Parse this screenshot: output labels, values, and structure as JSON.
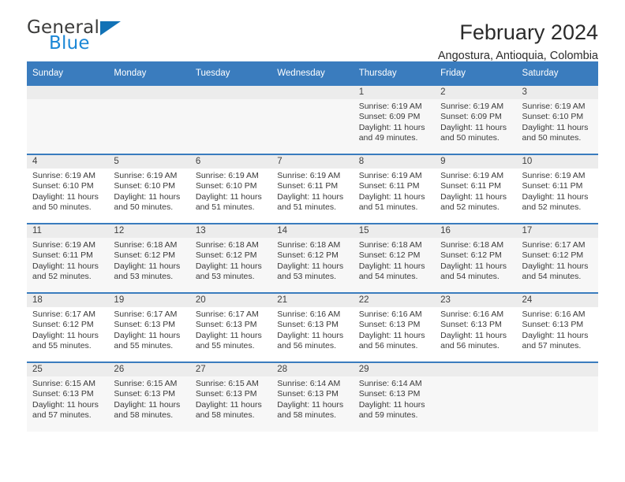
{
  "brand": {
    "name_top": "General",
    "name_bottom": "Blue",
    "triangle_color": "#1272b6",
    "blue_text_color": "#1b87d6"
  },
  "header": {
    "title": "February 2024",
    "subtitle": "Angostura, Antioquia, Colombia"
  },
  "theme": {
    "header_blue": "#3a7cbe",
    "daynum_band": "#ececec",
    "alt_row": "#f7f7f7",
    "text": "#3a3a3a"
  },
  "calendar": {
    "weekday_headers": [
      "Sunday",
      "Monday",
      "Tuesday",
      "Wednesday",
      "Thursday",
      "Friday",
      "Saturday"
    ],
    "weeks": [
      [
        {
          "day": "",
          "sunrise": "",
          "sunset": "",
          "daylight1": "",
          "daylight2": ""
        },
        {
          "day": "",
          "sunrise": "",
          "sunset": "",
          "daylight1": "",
          "daylight2": ""
        },
        {
          "day": "",
          "sunrise": "",
          "sunset": "",
          "daylight1": "",
          "daylight2": ""
        },
        {
          "day": "",
          "sunrise": "",
          "sunset": "",
          "daylight1": "",
          "daylight2": ""
        },
        {
          "day": "1",
          "sunrise": "Sunrise: 6:19 AM",
          "sunset": "Sunset: 6:09 PM",
          "daylight1": "Daylight: 11 hours",
          "daylight2": "and 49 minutes."
        },
        {
          "day": "2",
          "sunrise": "Sunrise: 6:19 AM",
          "sunset": "Sunset: 6:09 PM",
          "daylight1": "Daylight: 11 hours",
          "daylight2": "and 50 minutes."
        },
        {
          "day": "3",
          "sunrise": "Sunrise: 6:19 AM",
          "sunset": "Sunset: 6:10 PM",
          "daylight1": "Daylight: 11 hours",
          "daylight2": "and 50 minutes."
        }
      ],
      [
        {
          "day": "4",
          "sunrise": "Sunrise: 6:19 AM",
          "sunset": "Sunset: 6:10 PM",
          "daylight1": "Daylight: 11 hours",
          "daylight2": "and 50 minutes."
        },
        {
          "day": "5",
          "sunrise": "Sunrise: 6:19 AM",
          "sunset": "Sunset: 6:10 PM",
          "daylight1": "Daylight: 11 hours",
          "daylight2": "and 50 minutes."
        },
        {
          "day": "6",
          "sunrise": "Sunrise: 6:19 AM",
          "sunset": "Sunset: 6:10 PM",
          "daylight1": "Daylight: 11 hours",
          "daylight2": "and 51 minutes."
        },
        {
          "day": "7",
          "sunrise": "Sunrise: 6:19 AM",
          "sunset": "Sunset: 6:11 PM",
          "daylight1": "Daylight: 11 hours",
          "daylight2": "and 51 minutes."
        },
        {
          "day": "8",
          "sunrise": "Sunrise: 6:19 AM",
          "sunset": "Sunset: 6:11 PM",
          "daylight1": "Daylight: 11 hours",
          "daylight2": "and 51 minutes."
        },
        {
          "day": "9",
          "sunrise": "Sunrise: 6:19 AM",
          "sunset": "Sunset: 6:11 PM",
          "daylight1": "Daylight: 11 hours",
          "daylight2": "and 52 minutes."
        },
        {
          "day": "10",
          "sunrise": "Sunrise: 6:19 AM",
          "sunset": "Sunset: 6:11 PM",
          "daylight1": "Daylight: 11 hours",
          "daylight2": "and 52 minutes."
        }
      ],
      [
        {
          "day": "11",
          "sunrise": "Sunrise: 6:19 AM",
          "sunset": "Sunset: 6:11 PM",
          "daylight1": "Daylight: 11 hours",
          "daylight2": "and 52 minutes."
        },
        {
          "day": "12",
          "sunrise": "Sunrise: 6:18 AM",
          "sunset": "Sunset: 6:12 PM",
          "daylight1": "Daylight: 11 hours",
          "daylight2": "and 53 minutes."
        },
        {
          "day": "13",
          "sunrise": "Sunrise: 6:18 AM",
          "sunset": "Sunset: 6:12 PM",
          "daylight1": "Daylight: 11 hours",
          "daylight2": "and 53 minutes."
        },
        {
          "day": "14",
          "sunrise": "Sunrise: 6:18 AM",
          "sunset": "Sunset: 6:12 PM",
          "daylight1": "Daylight: 11 hours",
          "daylight2": "and 53 minutes."
        },
        {
          "day": "15",
          "sunrise": "Sunrise: 6:18 AM",
          "sunset": "Sunset: 6:12 PM",
          "daylight1": "Daylight: 11 hours",
          "daylight2": "and 54 minutes."
        },
        {
          "day": "16",
          "sunrise": "Sunrise: 6:18 AM",
          "sunset": "Sunset: 6:12 PM",
          "daylight1": "Daylight: 11 hours",
          "daylight2": "and 54 minutes."
        },
        {
          "day": "17",
          "sunrise": "Sunrise: 6:17 AM",
          "sunset": "Sunset: 6:12 PM",
          "daylight1": "Daylight: 11 hours",
          "daylight2": "and 54 minutes."
        }
      ],
      [
        {
          "day": "18",
          "sunrise": "Sunrise: 6:17 AM",
          "sunset": "Sunset: 6:12 PM",
          "daylight1": "Daylight: 11 hours",
          "daylight2": "and 55 minutes."
        },
        {
          "day": "19",
          "sunrise": "Sunrise: 6:17 AM",
          "sunset": "Sunset: 6:13 PM",
          "daylight1": "Daylight: 11 hours",
          "daylight2": "and 55 minutes."
        },
        {
          "day": "20",
          "sunrise": "Sunrise: 6:17 AM",
          "sunset": "Sunset: 6:13 PM",
          "daylight1": "Daylight: 11 hours",
          "daylight2": "and 55 minutes."
        },
        {
          "day": "21",
          "sunrise": "Sunrise: 6:16 AM",
          "sunset": "Sunset: 6:13 PM",
          "daylight1": "Daylight: 11 hours",
          "daylight2": "and 56 minutes."
        },
        {
          "day": "22",
          "sunrise": "Sunrise: 6:16 AM",
          "sunset": "Sunset: 6:13 PM",
          "daylight1": "Daylight: 11 hours",
          "daylight2": "and 56 minutes."
        },
        {
          "day": "23",
          "sunrise": "Sunrise: 6:16 AM",
          "sunset": "Sunset: 6:13 PM",
          "daylight1": "Daylight: 11 hours",
          "daylight2": "and 56 minutes."
        },
        {
          "day": "24",
          "sunrise": "Sunrise: 6:16 AM",
          "sunset": "Sunset: 6:13 PM",
          "daylight1": "Daylight: 11 hours",
          "daylight2": "and 57 minutes."
        }
      ],
      [
        {
          "day": "25",
          "sunrise": "Sunrise: 6:15 AM",
          "sunset": "Sunset: 6:13 PM",
          "daylight1": "Daylight: 11 hours",
          "daylight2": "and 57 minutes."
        },
        {
          "day": "26",
          "sunrise": "Sunrise: 6:15 AM",
          "sunset": "Sunset: 6:13 PM",
          "daylight1": "Daylight: 11 hours",
          "daylight2": "and 58 minutes."
        },
        {
          "day": "27",
          "sunrise": "Sunrise: 6:15 AM",
          "sunset": "Sunset: 6:13 PM",
          "daylight1": "Daylight: 11 hours",
          "daylight2": "and 58 minutes."
        },
        {
          "day": "28",
          "sunrise": "Sunrise: 6:14 AM",
          "sunset": "Sunset: 6:13 PM",
          "daylight1": "Daylight: 11 hours",
          "daylight2": "and 58 minutes."
        },
        {
          "day": "29",
          "sunrise": "Sunrise: 6:14 AM",
          "sunset": "Sunset: 6:13 PM",
          "daylight1": "Daylight: 11 hours",
          "daylight2": "and 59 minutes."
        },
        {
          "day": "",
          "sunrise": "",
          "sunset": "",
          "daylight1": "",
          "daylight2": ""
        },
        {
          "day": "",
          "sunrise": "",
          "sunset": "",
          "daylight1": "",
          "daylight2": ""
        }
      ]
    ]
  }
}
